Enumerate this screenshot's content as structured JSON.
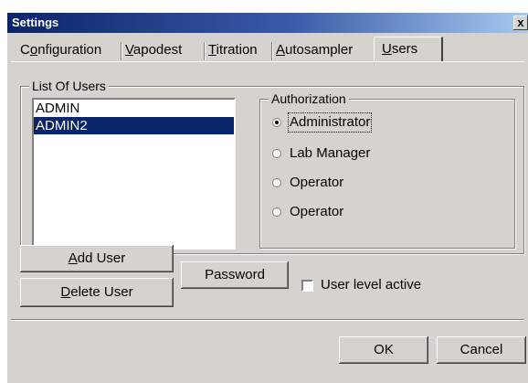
{
  "window": {
    "title": "Settings",
    "close_glyph": "x"
  },
  "tabs": [
    {
      "label": "Configuration",
      "underline_index": 1,
      "active": false
    },
    {
      "label": "Vapodest",
      "underline_index": 0,
      "active": false
    },
    {
      "label": "Titration",
      "underline_index": 0,
      "active": false
    },
    {
      "label": "Autosampler",
      "underline_index": 0,
      "active": false
    },
    {
      "label": "Users",
      "underline_index": 0,
      "active": true
    }
  ],
  "users_group": {
    "caption": "List Of Users",
    "items": [
      {
        "label": "ADMIN",
        "selected": false
      },
      {
        "label": "ADMIN2",
        "selected": true
      }
    ]
  },
  "authorization": {
    "caption": "Authorization",
    "options": [
      {
        "label": "Administrator",
        "checked": true
      },
      {
        "label": "Lab Manager",
        "checked": false
      },
      {
        "label": "Operator",
        "checked": false
      },
      {
        "label": "Operator",
        "checked": false
      }
    ]
  },
  "buttons": {
    "add_user_prefix": "",
    "add_user_accel": "A",
    "add_user_rest": "dd User",
    "delete_user_accel": "D",
    "delete_user_rest": "elete User",
    "password": "Password",
    "ok": "OK",
    "cancel": "Cancel"
  },
  "user_level": {
    "label": "User level active",
    "checked": false
  },
  "colors": {
    "dialog_bg": "#d6d3ce",
    "selection": "#0a246a",
    "titlebar": "#0a246a"
  }
}
